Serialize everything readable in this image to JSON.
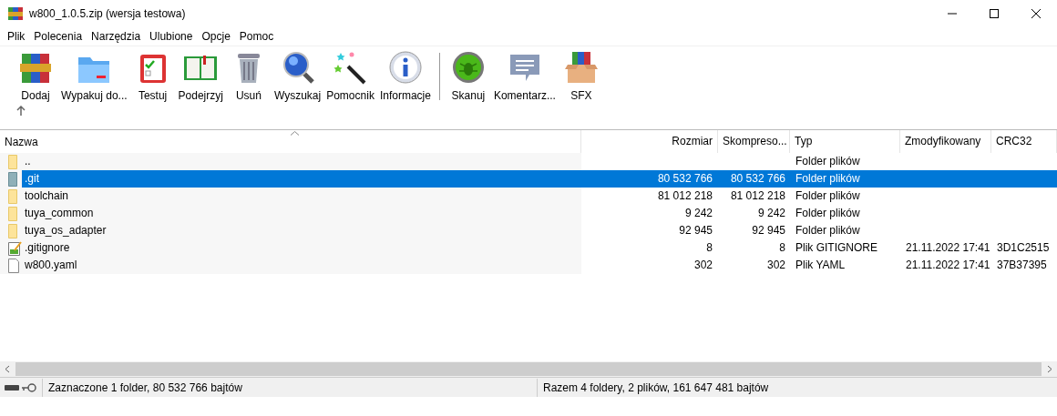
{
  "window": {
    "title": "w800_1.0.5.zip (wersja testowa)"
  },
  "menu": [
    "Plik",
    "Polecenia",
    "Narzędzia",
    "Ulubione",
    "Opcje",
    "Pomoc"
  ],
  "toolbar": [
    {
      "label": "Dodaj",
      "kind": "add"
    },
    {
      "label": "Wypakuj do...",
      "kind": "extract"
    },
    {
      "label": "Testuj",
      "kind": "test"
    },
    {
      "label": "Podejrzyj",
      "kind": "view"
    },
    {
      "label": "Usuń",
      "kind": "delete"
    },
    {
      "label": "Wyszukaj",
      "kind": "find"
    },
    {
      "label": "Pomocnik",
      "kind": "wizard"
    },
    {
      "label": "Informacje",
      "kind": "info"
    },
    {
      "label": "Skanuj",
      "kind": "scan",
      "separator_before": true
    },
    {
      "label": "Komentarz...",
      "kind": "comment"
    },
    {
      "label": "SFX",
      "kind": "sfx"
    }
  ],
  "table": {
    "columns": [
      {
        "label": "Nazwa",
        "sorted": true
      },
      {
        "label": "Rozmiar",
        "sorted": false
      },
      {
        "label": "Skompreso...",
        "sorted": false
      },
      {
        "label": "Typ",
        "sorted": false
      },
      {
        "label": "Zmodyfikowany",
        "sorted": false
      },
      {
        "label": "CRC32",
        "sorted": false
      }
    ],
    "rows": [
      {
        "kind": "folder",
        "selected": false,
        "cells": [
          "..",
          "",
          "",
          "Folder plików",
          "",
          ""
        ]
      },
      {
        "kind": "folder",
        "selected": true,
        "cells": [
          ".git",
          "80 532 766",
          "80 532 766",
          "Folder plików",
          "",
          ""
        ]
      },
      {
        "kind": "folder",
        "selected": false,
        "cells": [
          "toolchain",
          "81 012 218",
          "81 012 218",
          "Folder plików",
          "",
          ""
        ]
      },
      {
        "kind": "folder",
        "selected": false,
        "cells": [
          "tuya_common",
          "9 242",
          "9 242",
          "Folder plików",
          "",
          ""
        ]
      },
      {
        "kind": "folder",
        "selected": false,
        "cells": [
          "tuya_os_adapter",
          "92 945",
          "92 945",
          "Folder plików",
          "",
          ""
        ]
      },
      {
        "kind": "text",
        "selected": false,
        "cells": [
          ".gitignore",
          "8",
          "8",
          "Plik GITIGNORE",
          "21.11.2022 17:41",
          "3D1C2515"
        ]
      },
      {
        "kind": "file",
        "selected": false,
        "cells": [
          "w800.yaml",
          "302",
          "302",
          "Plik YAML",
          "21.11.2022 17:41",
          "37B37395"
        ]
      }
    ]
  },
  "status_bar": {
    "left": "Zaznaczone 1 folder, 80 532 766 bajtów",
    "right": "Razem 4 foldery, 2 plików, 161 647 481 bajtów"
  }
}
